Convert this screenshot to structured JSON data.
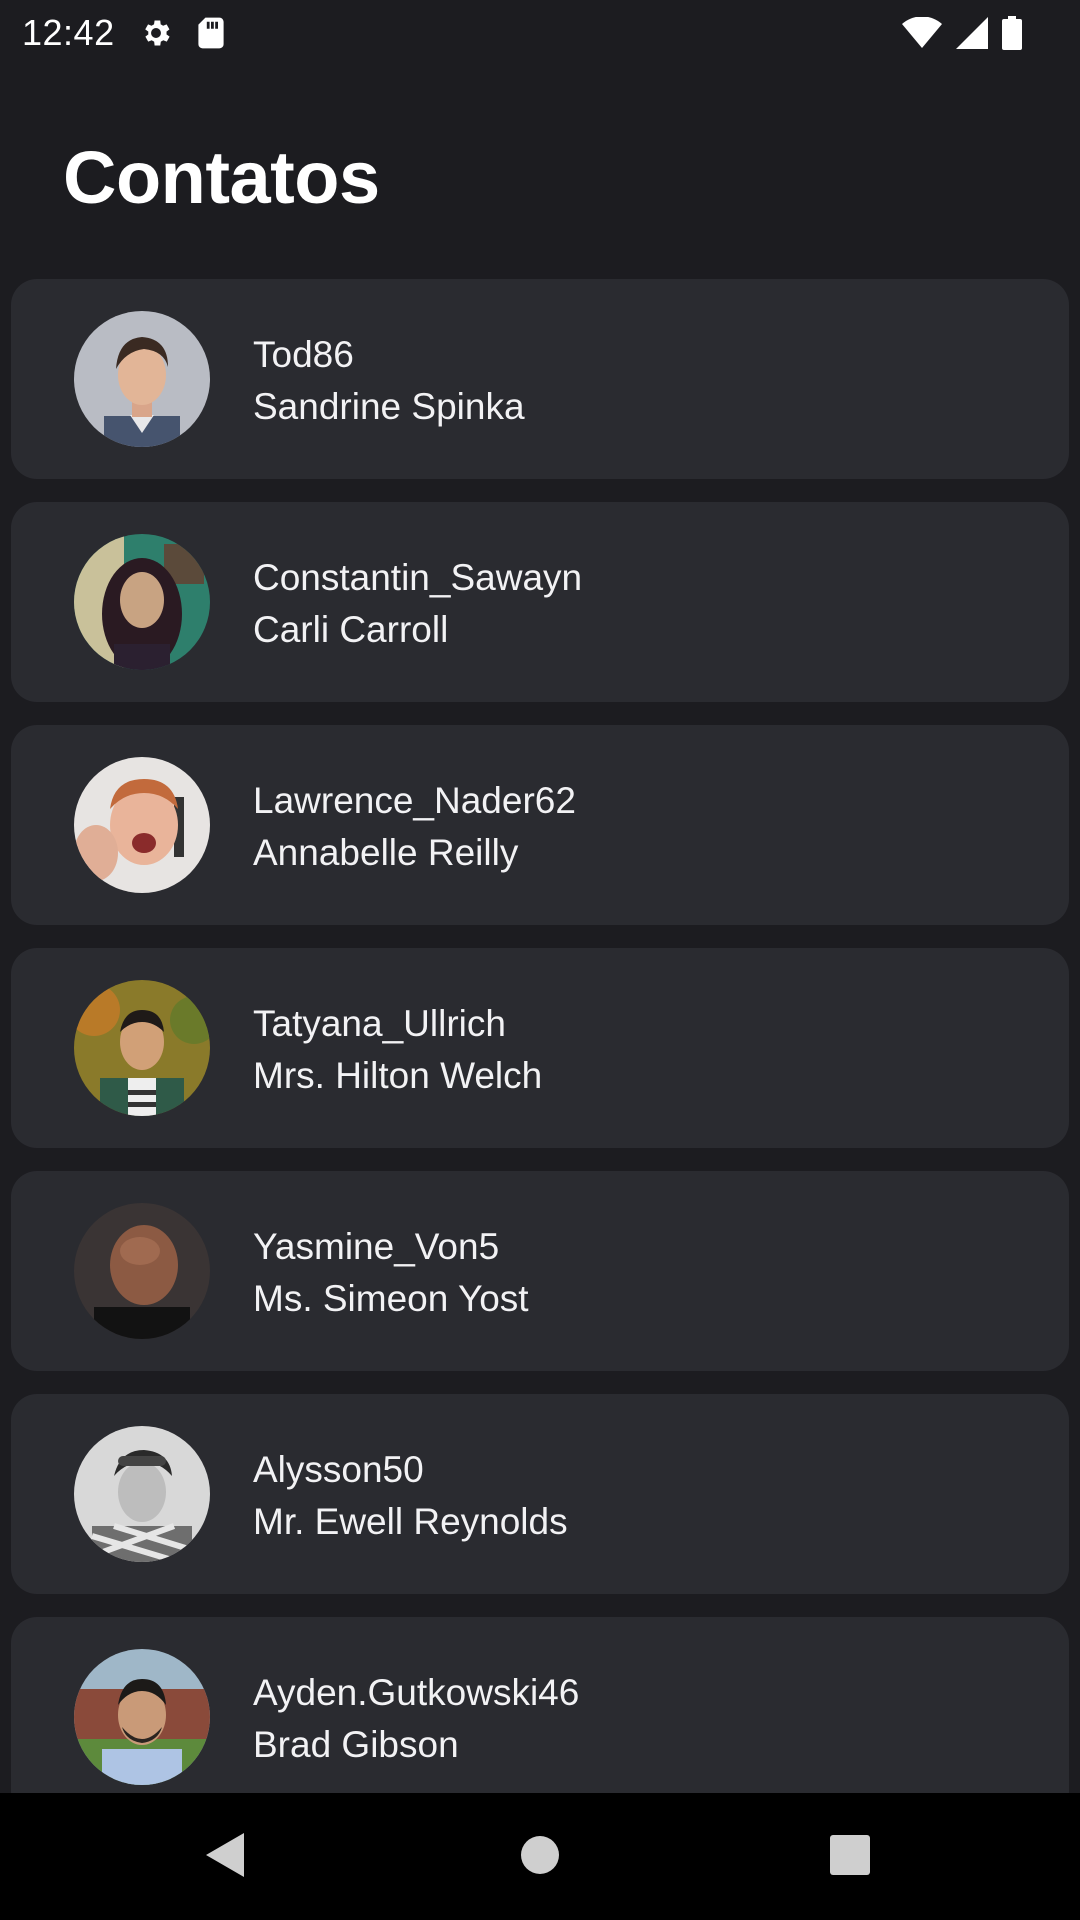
{
  "status_bar": {
    "time": "12:42",
    "left_icons": [
      "gear-icon",
      "sd-card-icon"
    ],
    "right_icons": [
      "wifi-icon",
      "cell-signal-icon",
      "battery-icon"
    ]
  },
  "header": {
    "title": "Contatos"
  },
  "contacts": [
    {
      "username": "Tod86",
      "name": "Sandrine Spinka",
      "avatar": "avatar-photo"
    },
    {
      "username": "Constantin_Sawayn",
      "name": "Carli Carroll",
      "avatar": "avatar-photo"
    },
    {
      "username": "Lawrence_Nader62",
      "name": "Annabelle Reilly",
      "avatar": "avatar-photo"
    },
    {
      "username": "Tatyana_Ullrich",
      "name": "Mrs. Hilton Welch",
      "avatar": "avatar-photo"
    },
    {
      "username": "Yasmine_Von5",
      "name": "Ms. Simeon Yost",
      "avatar": "avatar-photo"
    },
    {
      "username": "Alysson50",
      "name": "Mr. Ewell Reynolds",
      "avatar": "avatar-photo"
    },
    {
      "username": "Ayden.Gutkowski46",
      "name": "Brad Gibson",
      "avatar": "avatar-photo"
    }
  ],
  "nav_bar": {
    "buttons": [
      "back-icon",
      "home-icon",
      "recents-icon"
    ]
  },
  "colors": {
    "background": "#1c1c20",
    "card": "#2a2b30",
    "text": "#f2f2f4",
    "nav_bar": "#000000"
  }
}
